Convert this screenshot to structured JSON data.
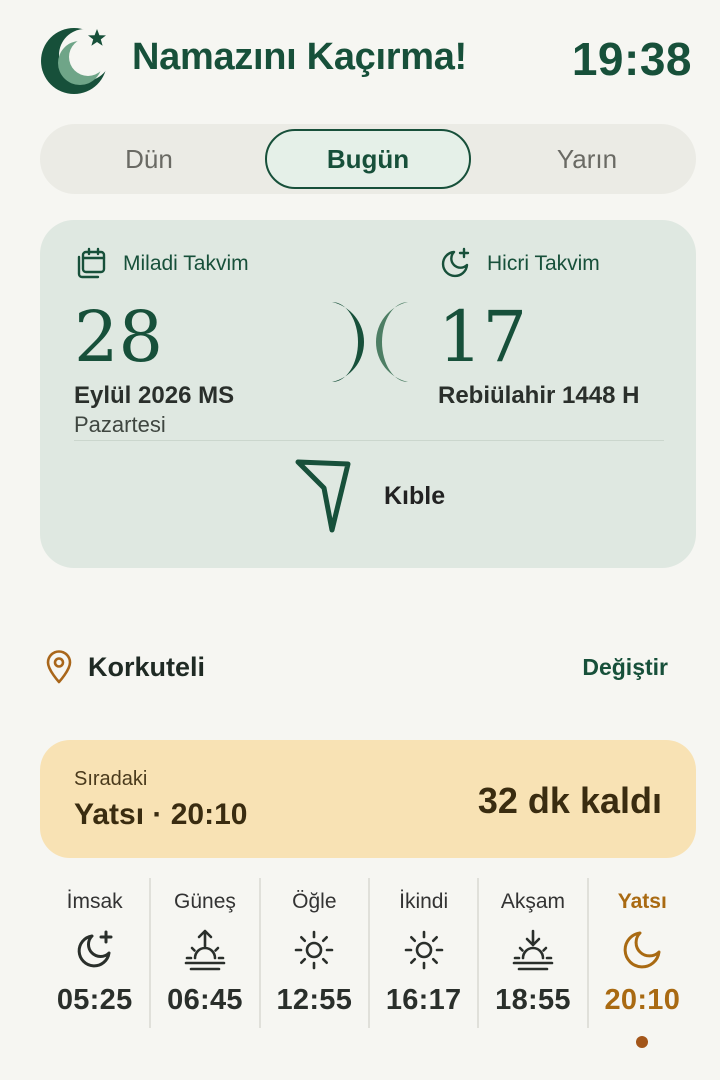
{
  "header": {
    "app_title": "Namazını Kaçırma!",
    "clock": "19:38",
    "logo_icon": "crescent-star-icon"
  },
  "day_tabs": [
    {
      "label": "Dün",
      "active": false
    },
    {
      "label": "Bugün",
      "active": true
    },
    {
      "label": "Yarın",
      "active": false
    }
  ],
  "calendar": {
    "gregorian": {
      "label": "Miladi Takvim",
      "icon": "calendar-icon",
      "day": "28",
      "month_year": "Eylül 2026 MS",
      "weekday": "Pazartesi"
    },
    "hijri": {
      "label": "Hicri Takvim",
      "icon": "moon-star-icon",
      "day": "17",
      "month_year": "Rebiülahir 1448 H"
    },
    "qibla": {
      "label": "Kıble",
      "icon": "qibla-arrow-icon"
    }
  },
  "location": {
    "name": "Korkuteli",
    "change_label": "Değiştir",
    "icon": "location-pin-icon"
  },
  "next_prayer": {
    "label": "Sıradaki",
    "prayer": "Yatsı · 20:10",
    "remaining": "32 dk kaldı"
  },
  "prayers": [
    {
      "name": "İmsak",
      "time": "05:25",
      "icon": "moon-star-icon"
    },
    {
      "name": "Güneş",
      "time": "06:45",
      "icon": "sunrise-icon"
    },
    {
      "name": "Öğle",
      "time": "12:55",
      "icon": "sun-icon"
    },
    {
      "name": "İkindi",
      "time": "16:17",
      "icon": "sun-icon"
    },
    {
      "name": "Akşam",
      "time": "18:55",
      "icon": "sunset-icon"
    },
    {
      "name": "Yatsı",
      "time": "20:10",
      "icon": "moon-icon",
      "current": true
    }
  ],
  "colors": {
    "primary": "#17503a",
    "background": "#f6f6f2",
    "card": "#dfe8e1",
    "highlight_card": "#f8e2b4",
    "current_prayer": "#a96a12"
  }
}
